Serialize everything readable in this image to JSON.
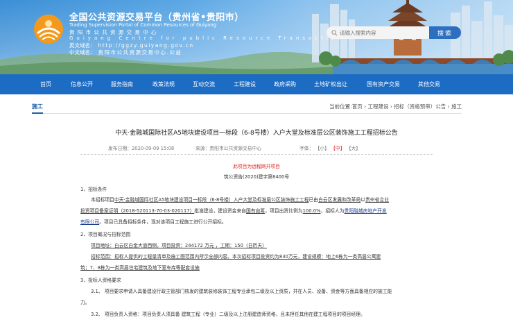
{
  "header": {
    "title_cn": "全国公共资源交易平台（贵州省•贵阳市）",
    "title_en": "Trading Supervision Portal of Common Resources of Guiyang",
    "sub_cn": "贵阳市公共资源交易中心",
    "sub_en": "Guiyang Centre for public Resource Transaction",
    "web_label": "英文域名：",
    "web_value": "http://ggzy.guiyang.gov.cn",
    "cn_label": "中文域名：",
    "cn_value": "贵阳市公共资源交易中心.公益"
  },
  "search": {
    "placeholder": "请输入搜索内容",
    "button": "搜索"
  },
  "nav": [
    "首页",
    "信息公开",
    "服务指南",
    "政策法规",
    "互动交流",
    "工程建设",
    "政府采购",
    "土地矿权出让",
    "国有资产交易",
    "其他交易"
  ],
  "breadcrumb": {
    "section": "施工",
    "path": "当前位置:首页 › 工程建设 › 招标（资格预审）公告 › 施工"
  },
  "article": {
    "title": "中天·金融城国际社区A5地块建设项目一标段（6-8号楼）入户大堂及标准层公区装饰施工工程招标公告",
    "published": "发布日期：2020-09-09 15:08",
    "source": "来源：贵阳市公共资源交易中心",
    "fontsize_label": "字体：",
    "font_small": "【小】",
    "font_mid": "【中】",
    "font_large": "【大】",
    "notice": "此项目为远程网开项目",
    "number": "筑公资告(2020)建字第8400号",
    "s1_title": "1、招标条件",
    "s1_a": "本招标项目",
    "s1_b": "中天·金融城国际社区A5地块建设项目一标段（6-8号楼）入户大堂及标准层公区装饰施工工程",
    "s1_c": "已由",
    "s1_d": "白云区发展和改革局",
    "s1_e": "以",
    "s1_f": "贵州省企业",
    "s1_g": "投资项目备案证明（2018-520113-70-03-020117）",
    "s1_h": "批准建设，建设资金来自",
    "s1_i": "国有自筹",
    "s1_j": "，项目出资比例为",
    "s1_k": "100.0%",
    "s1_l": "，招标人为",
    "s1_m": "贵阳融城房地产开发",
    "s1_n": "有限公司",
    "s1_o": "。项目已具备招标条件，现对该项目工程施工进行公开招标。",
    "s2_title": "2、项目概况与招标范围",
    "s2_a": "项目地址：白云区白金大道西侧，项目投资：244172 万元 ，工期：150（日历天）",
    "s2_b": "招标范围：招标人提供的工程量清单及施工图范围内所示全部内容。本次招标项目投资约为830万元，建设规模：地上6栋为一类高层公寓建",
    "s2_c": "筑；7、8栋为一类高层住宅建筑及地下室车库等配套设施",
    "s3_title": "3、投标人资格要求",
    "s3_1a": "3.1、 项目要求申请人具备建设行政主管部门核发的建筑装修装饰工程专业承包二级及以上资质，并在人员、设备、资金等方面具备相应的施工能",
    "s3_1b": "力。",
    "s3_2": "3.2、 项目负责人资格：项目负责人须具备 建筑工程（专业）二级及以上注册建造师资格，且未担任其他在建工程项目的项目经理。"
  },
  "colors": {
    "nav_bg": "#1d6cc4",
    "link_red": "#d22222",
    "accent_blue": "#1d5fa8"
  }
}
